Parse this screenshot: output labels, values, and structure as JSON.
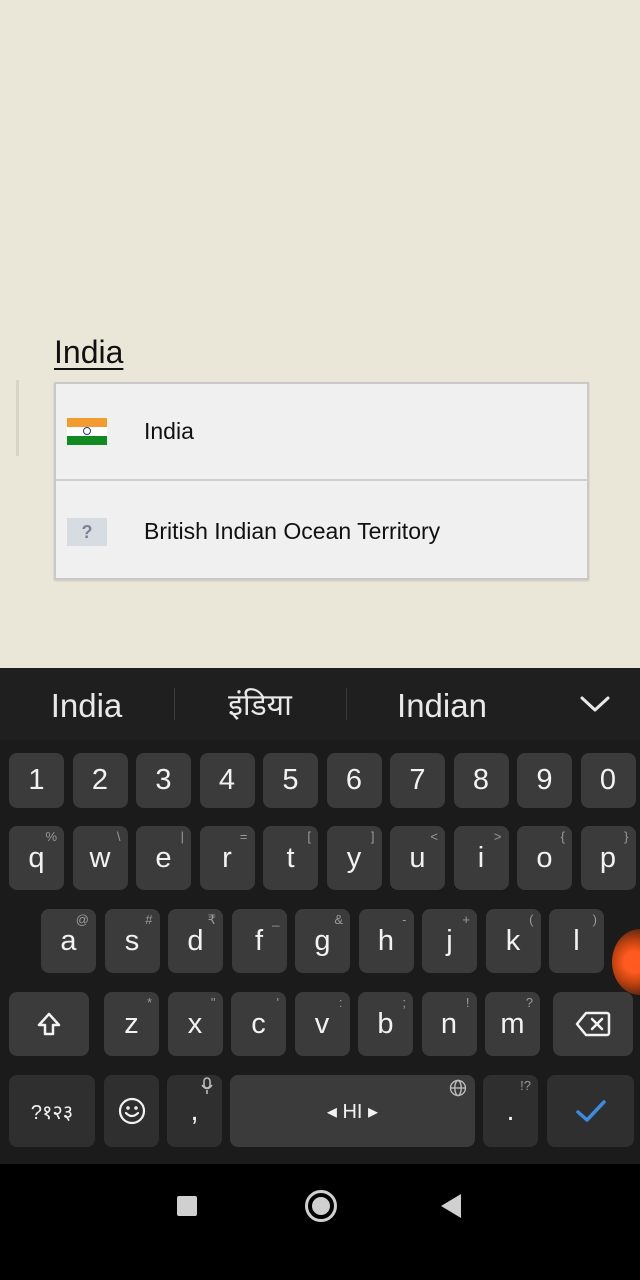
{
  "search": {
    "text": "India"
  },
  "dropdown": {
    "options": [
      {
        "label": "India",
        "flag": "india-flag"
      },
      {
        "label": "British Indian Ocean Territory",
        "flag": "unknown-flag",
        "flag_glyph": "?"
      }
    ]
  },
  "keyboard": {
    "suggestions": [
      "India",
      "इंडिया",
      "Indian"
    ],
    "number_row": [
      "1",
      "2",
      "3",
      "4",
      "5",
      "6",
      "7",
      "8",
      "9",
      "0"
    ],
    "row1": [
      {
        "key": "q",
        "hint": "%"
      },
      {
        "key": "w",
        "hint": "\\"
      },
      {
        "key": "e",
        "hint": "|"
      },
      {
        "key": "r",
        "hint": "="
      },
      {
        "key": "t",
        "hint": "["
      },
      {
        "key": "y",
        "hint": "]"
      },
      {
        "key": "u",
        "hint": "<"
      },
      {
        "key": "i",
        "hint": ">"
      },
      {
        "key": "o",
        "hint": "{"
      },
      {
        "key": "p",
        "hint": "}"
      }
    ],
    "row2": [
      {
        "key": "a",
        "hint": "@"
      },
      {
        "key": "s",
        "hint": "#"
      },
      {
        "key": "d",
        "hint": "₹"
      },
      {
        "key": "f",
        "hint": "_"
      },
      {
        "key": "g",
        "hint": "&"
      },
      {
        "key": "h",
        "hint": "-"
      },
      {
        "key": "j",
        "hint": "+"
      },
      {
        "key": "k",
        "hint": "("
      },
      {
        "key": "l",
        "hint": ")"
      }
    ],
    "row3": [
      {
        "key": "z",
        "hint": "*"
      },
      {
        "key": "x",
        "hint": "\""
      },
      {
        "key": "c",
        "hint": "'"
      },
      {
        "key": "v",
        "hint": ":"
      },
      {
        "key": "b",
        "hint": ";"
      },
      {
        "key": "n",
        "hint": "!"
      },
      {
        "key": "m",
        "hint": "?"
      }
    ],
    "symbols_label": "?१२३",
    "comma_label": ",",
    "space_label": "◂ HI ▸",
    "period_label": ".",
    "period_hint": "!?",
    "accent_color": "#3d8be0"
  },
  "navbar": {
    "icons": [
      "recents-icon",
      "home-icon",
      "back-icon"
    ]
  }
}
